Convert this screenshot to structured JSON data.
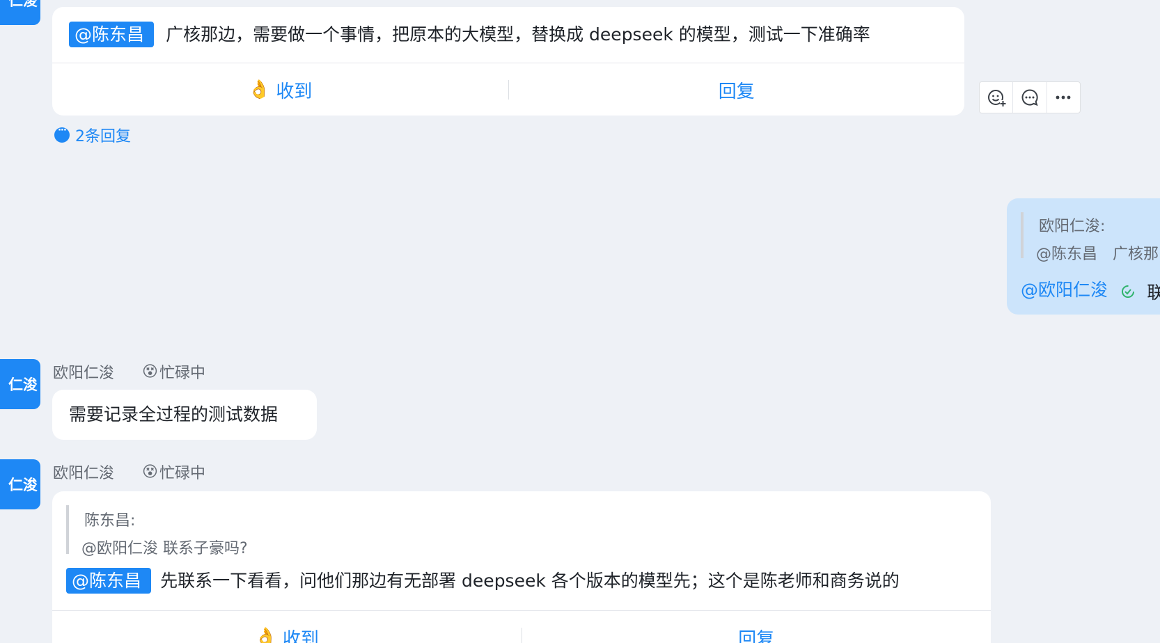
{
  "messages": [
    {
      "avatar_text": "仁浚",
      "mention": "@陈东昌",
      "text": "广核那边，需要做一个事情，把原本的大模型，替换成 deepseek 的模型，测试一下准确率",
      "actions": {
        "ack": "收到",
        "reply": "回复"
      },
      "reply_count": "2条回复"
    },
    {
      "quote_author": "欧阳仁浚:",
      "quote_text": "@陈东昌　广核那",
      "mention": "@欧阳仁浚",
      "text_fragment": "联"
    },
    {
      "avatar_text": "仁浚",
      "sender": "欧阳仁浚",
      "status": "忙碌中",
      "text": "需要记录全过程的测试数据"
    },
    {
      "avatar_text": "仁浚",
      "sender": "欧阳仁浚",
      "status": "忙碌中",
      "quote_author": "陈东昌:",
      "quote_text": "@欧阳仁浚  联系子豪吗?",
      "mention": "@陈东昌",
      "text": "先联系一下看看，问他们那边有无部署 deepseek 各个版本的模型先；这个是陈老师和商务说的",
      "actions": {
        "ack": "收到",
        "reply": "回复"
      }
    }
  ],
  "toolbar": {
    "icons": [
      "emoji-add-icon",
      "comment-icon",
      "more-icon"
    ]
  },
  "colors": {
    "accent": "#1e88f5",
    "background": "#eef1f6",
    "self_bubble": "#cce4fb"
  }
}
